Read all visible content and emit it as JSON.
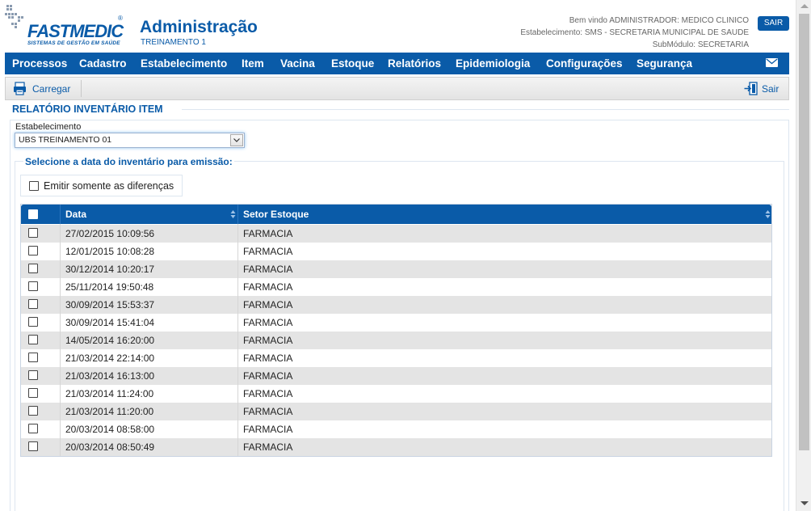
{
  "logo": {
    "name": "FASTMEDIC",
    "tagline": "SISTEMAS DE GESTÃO EM SAÚDE",
    "reg": "®"
  },
  "header": {
    "title": "Administração",
    "subtitle": "TREINAMENTO 1",
    "welcome": "Bem vindo ADMINISTRADOR: MEDICO CLINICO",
    "establishment": "Estabelecimento: SMS - SECRETARIA MUNICIPAL DE SAUDE",
    "submodule": "SubMódulo: SECRETARIA",
    "logout_label": "SAIR"
  },
  "menu": {
    "items": [
      {
        "label": "Processos"
      },
      {
        "label": "Cadastro"
      },
      {
        "label": "Estabelecimento"
      },
      {
        "label": "Item"
      },
      {
        "label": "Vacina"
      },
      {
        "label": "Estoque"
      },
      {
        "label": "Relatórios"
      },
      {
        "label": "Epidemiologia"
      },
      {
        "label": "Configurações"
      },
      {
        "label": "Segurança"
      }
    ],
    "mail_icon": "envelope-icon"
  },
  "toolbar": {
    "load_label": "Carregar",
    "exit_label": "Sair"
  },
  "report": {
    "title": "RELATÓRIO INVENTÁRIO ITEM",
    "establishment_label": "Estabelecimento",
    "establishment_value": "UBS TREINAMENTO 01",
    "select_date_label": "Selecione a data do inventário para emissão:",
    "only_differences_label": "Emitir somente as diferenças"
  },
  "table": {
    "columns": [
      "Data",
      "Setor Estoque"
    ],
    "rows": [
      {
        "date": "27/02/2015 10:09:56",
        "sector": "FARMACIA"
      },
      {
        "date": "12/01/2015 10:08:28",
        "sector": "FARMACIA"
      },
      {
        "date": "30/12/2014 10:20:17",
        "sector": "FARMACIA"
      },
      {
        "date": "25/11/2014 19:50:48",
        "sector": "FARMACIA"
      },
      {
        "date": "30/09/2014 15:53:37",
        "sector": "FARMACIA"
      },
      {
        "date": "30/09/2014 15:41:04",
        "sector": "FARMACIA"
      },
      {
        "date": "14/05/2014 16:20:00",
        "sector": "FARMACIA"
      },
      {
        "date": "21/03/2014 22:14:00",
        "sector": "FARMACIA"
      },
      {
        "date": "21/03/2014 16:13:00",
        "sector": "FARMACIA"
      },
      {
        "date": "21/03/2014 11:24:00",
        "sector": "FARMACIA"
      },
      {
        "date": "21/03/2014 11:20:00",
        "sector": "FARMACIA"
      },
      {
        "date": "20/03/2014 08:58:00",
        "sector": "FARMACIA"
      },
      {
        "date": "20/03/2014 08:50:49",
        "sector": "FARMACIA"
      }
    ]
  },
  "colors": {
    "brand": "#0a5ba8",
    "row_alt": "#e4e4e4"
  }
}
